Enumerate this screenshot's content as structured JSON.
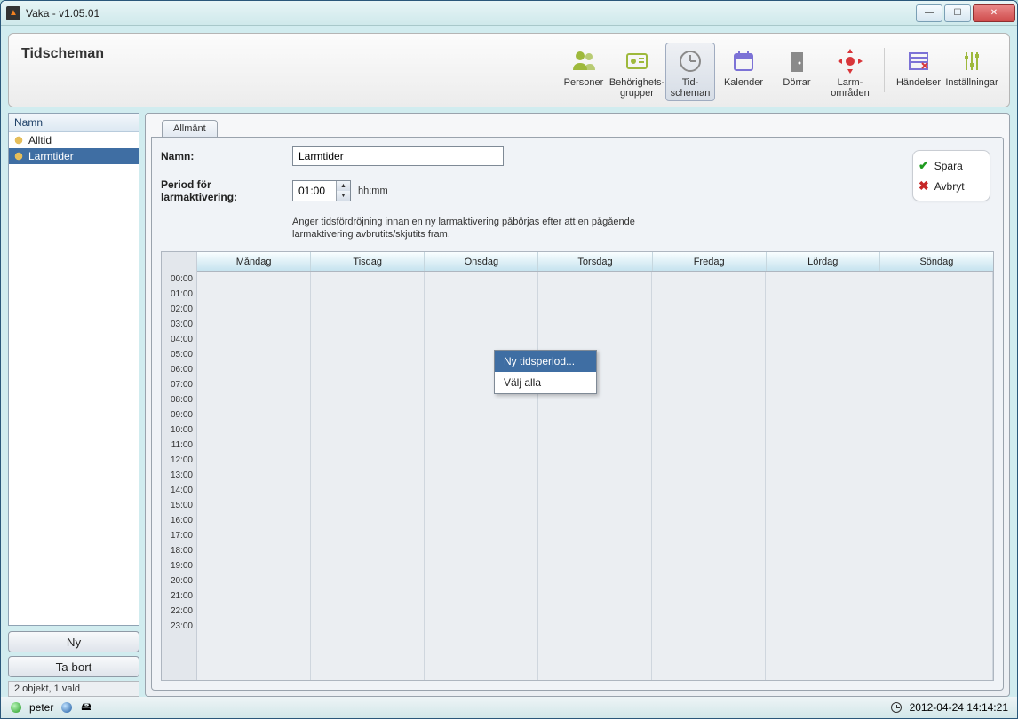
{
  "window": {
    "title": "Vaka - v1.05.01"
  },
  "toolbar": {
    "heading": "Tidscheman",
    "buttons": {
      "personer": "Personer",
      "behorighets": "Behörighets-\ngrupper",
      "tidscheman": "Tid-\nscheman",
      "kalender": "Kalender",
      "dorrar": "Dörrar",
      "larmomraden": "Larm-\nområden",
      "handelser": "Händelser",
      "installningar": "Inställningar"
    }
  },
  "sidebar": {
    "heading": "Namn",
    "items": [
      "Alltid",
      "Larmtider"
    ],
    "selected_index": 1,
    "new_btn": "Ny",
    "delete_btn": "Ta bort",
    "status": "2 objekt, 1 vald"
  },
  "tabs": {
    "general": "Allmänt"
  },
  "form": {
    "name_label": "Namn:",
    "name_value": "Larmtider",
    "period_label": "Period för larmaktivering:",
    "period_value": "01:00",
    "period_hint": "hh:mm",
    "help": "Anger tidsfördröjning innan en ny larmaktivering påbörjas efter att en pågående larmaktivering avbrutits/skjutits fram."
  },
  "actions": {
    "save": "Spara",
    "cancel": "Avbryt"
  },
  "schedule": {
    "days": [
      "Måndag",
      "Tisdag",
      "Onsdag",
      "Torsdag",
      "Fredag",
      "Lördag",
      "Söndag"
    ],
    "hours": [
      "00:00",
      "01:00",
      "02:00",
      "03:00",
      "04:00",
      "05:00",
      "06:00",
      "07:00",
      "08:00",
      "09:00",
      "10:00",
      "11:00",
      "12:00",
      "13:00",
      "14:00",
      "15:00",
      "16:00",
      "17:00",
      "18:00",
      "19:00",
      "20:00",
      "21:00",
      "22:00",
      "23:00"
    ]
  },
  "context_menu": {
    "new_period": "Ny tidsperiod...",
    "select_all": "Välj alla"
  },
  "statusbar": {
    "user": "peter",
    "timestamp": "2012-04-24 14:14:21"
  }
}
